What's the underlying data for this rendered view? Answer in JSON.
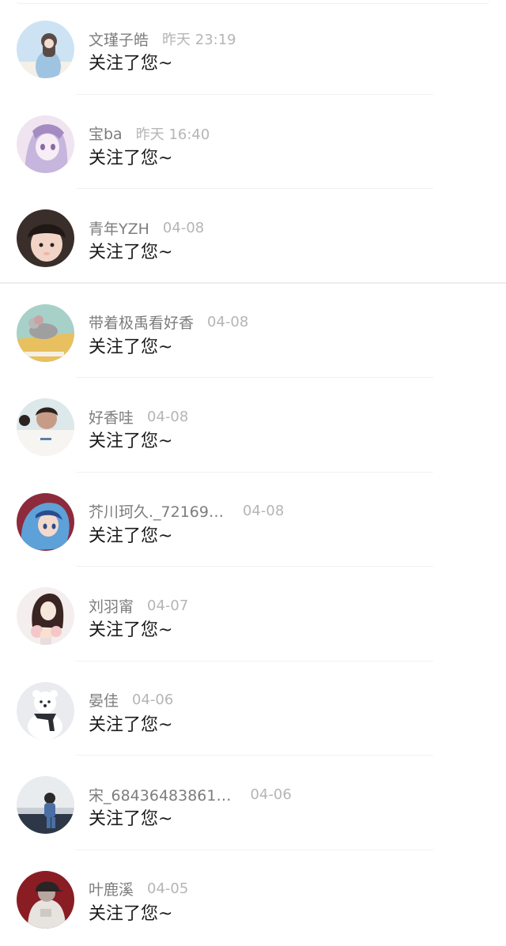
{
  "notifications": [
    {
      "name": "文瑾子皓",
      "time": "昨天 23:19",
      "message": "关注了您~",
      "avatar_icon": "girl-with-flower-avatar",
      "colors": [
        "#cde3f3",
        "#f4f0e8",
        "#5a4a44",
        "#9ec4e2"
      ]
    },
    {
      "name": "宝ba",
      "time": "昨天 16:40",
      "message": "关注了您~",
      "avatar_icon": "anime-girl-purple-avatar",
      "colors": [
        "#efe4f0",
        "#c6b5dc",
        "#8b6aa8",
        "#f7eef5"
      ]
    },
    {
      "name": "青年YZH",
      "time": "04-08",
      "message": "关注了您~",
      "avatar_icon": "child-photo-avatar",
      "colors": [
        "#3a2e2a",
        "#f2d4c6",
        "#1f1815",
        "#e8b9a8"
      ]
    },
    {
      "name": "带着极禹看好香",
      "time": "04-08",
      "message": "关注了您~",
      "avatar_icon": "cartoon-mouse-avatar",
      "colors": [
        "#a7d0c9",
        "#e8c060",
        "#9f9f9f",
        "#f5f0e0"
      ]
    },
    {
      "name": "好香哇",
      "time": "04-08",
      "message": "关注了您~",
      "avatar_icon": "school-boy-avatar",
      "colors": [
        "#dce8ea",
        "#2c2320",
        "#f7f5f2",
        "#c79c86"
      ]
    },
    {
      "name": "芥川珂久._72169…",
      "time": "04-08",
      "message": "关注了您~",
      "avatar_icon": "anime-blue-hair-avatar",
      "colors": [
        "#5ea0d8",
        "#8d2a3c",
        "#f3d9cc",
        "#2b4b8a"
      ]
    },
    {
      "name": "刘羽甯",
      "time": "04-07",
      "message": "关注了您~",
      "avatar_icon": "girl-bouquet-avatar",
      "colors": [
        "#f4eeee",
        "#3a2523",
        "#f6e7dc",
        "#f4c7c9"
      ]
    },
    {
      "name": "晏佳",
      "time": "04-06",
      "message": "关注了您~",
      "avatar_icon": "snow-bear-avatar",
      "colors": [
        "#e9ebee",
        "#ffffff",
        "#2b2f33",
        "#cfd3d8"
      ]
    },
    {
      "name": "宋_68436483861…",
      "time": "04-06",
      "message": "关注了您~",
      "avatar_icon": "person-sitting-avatar",
      "colors": [
        "#e9ecef",
        "#2d3748",
        "#4a6fa5",
        "#c9ced6"
      ]
    },
    {
      "name": "叶鹿溪",
      "time": "04-05",
      "message": "关注了您~",
      "avatar_icon": "person-cap-avatar",
      "colors": [
        "#8a1d24",
        "#e7e3de",
        "#2a2424",
        "#b7a7a0"
      ]
    }
  ]
}
